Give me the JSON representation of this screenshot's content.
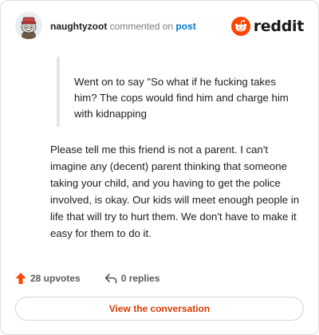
{
  "header": {
    "username": "naughtyzoot",
    "action_text": "commented on",
    "post_link_label": "post",
    "brand_name": "reddit"
  },
  "comment": {
    "quote": "Went on to say \"So what if he fucking takes him? The cops would find him and charge him with kidnapping",
    "body": "Please tell me this friend is not a parent. I can't imagine any (decent) parent thinking that someone taking your child, and you having to get the police involved, is okay. Our kids will meet enough people in life that will try to hurt them. We don't have to make it easy for them to do it."
  },
  "stats": {
    "upvotes": "28 upvotes",
    "replies": "0 replies"
  },
  "cta": {
    "label": "View the conversation"
  },
  "colors": {
    "brand_orange": "#ff4500",
    "accent_link": "#0079d3",
    "cta_text": "#d93a00"
  },
  "icons": {
    "avatar": "snoo-avatar-icon",
    "brand": "reddit-logo-icon",
    "upvote": "upvote-arrow-icon",
    "reply": "reply-arrow-icon"
  }
}
